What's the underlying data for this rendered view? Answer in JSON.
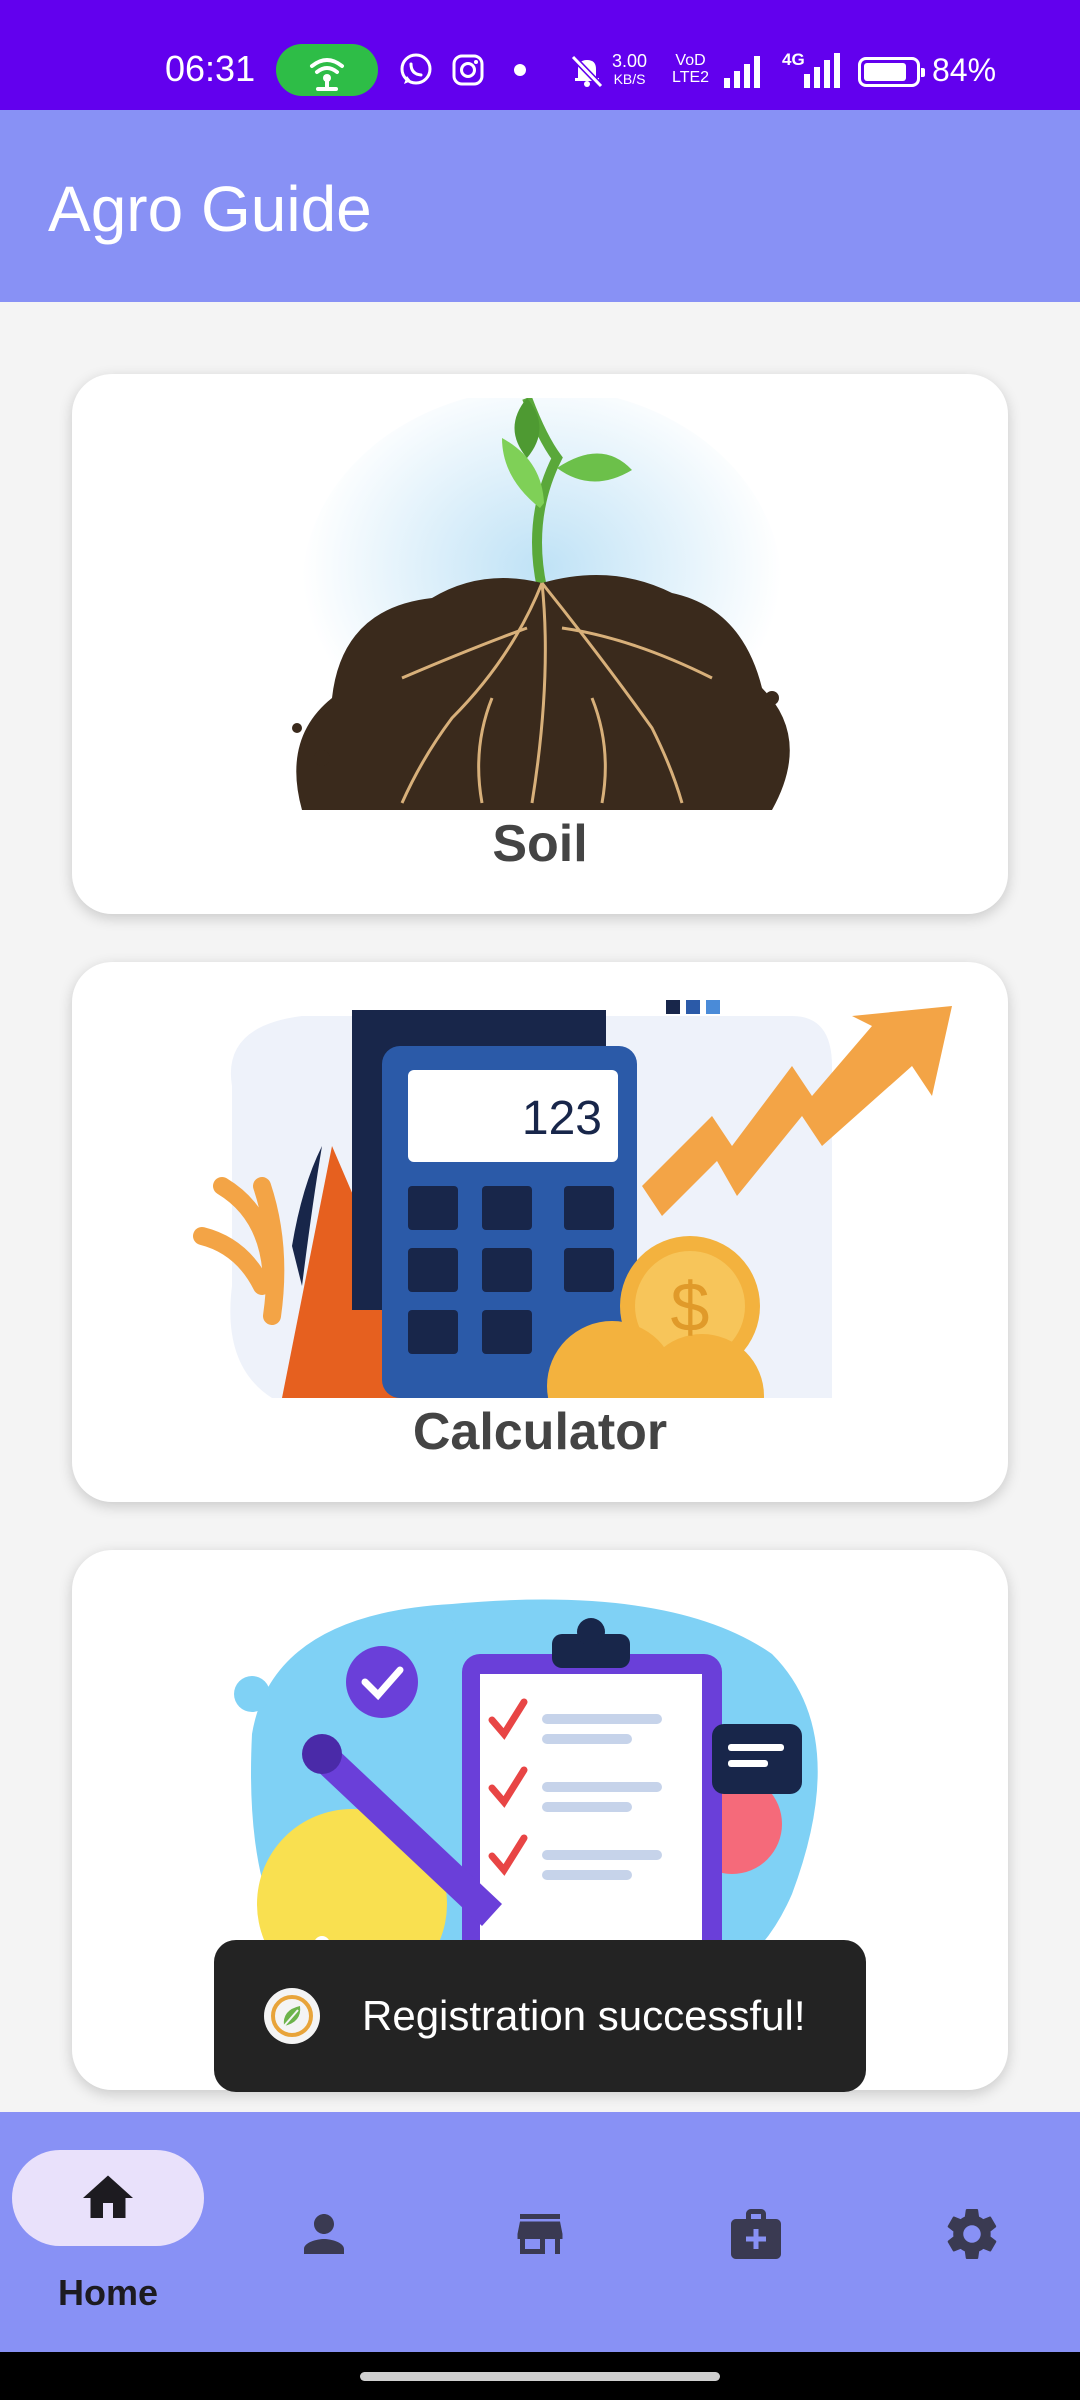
{
  "status_bar": {
    "time": "06:31",
    "speed_value": "3.00",
    "speed_unit": "KB/S",
    "volte_line1": "VoD",
    "volte_line2": "LTE2",
    "network_label": "4G",
    "battery_percent": "84%",
    "battery_level": 0.84
  },
  "app_bar": {
    "title": "Agro Guide"
  },
  "cards": [
    {
      "label": "Soil",
      "icon": "soil-plant-illustration"
    },
    {
      "label": "Calculator",
      "icon": "calculator-illustration",
      "display_value": "123"
    },
    {
      "label": "",
      "icon": "checklist-clipboard-illustration"
    }
  ],
  "toast": {
    "message": "Registration successful!"
  },
  "bottom_nav": {
    "items": [
      {
        "label": "Home",
        "icon": "home-icon",
        "selected": true
      },
      {
        "icon": "person-icon"
      },
      {
        "icon": "store-icon"
      },
      {
        "icon": "medical-kit-icon"
      },
      {
        "icon": "gear-icon"
      }
    ]
  },
  "colors": {
    "status_bar": "#6200ee",
    "app_bar": "#8891f5",
    "nav_pill": "#e9e1fb",
    "toast_bg": "#232323"
  }
}
